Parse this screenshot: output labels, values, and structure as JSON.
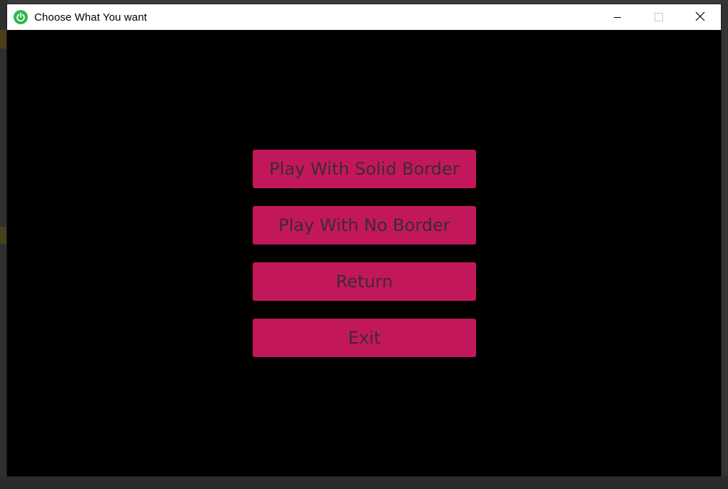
{
  "window": {
    "title": "Choose What You want",
    "icon": "power-icon",
    "controls": [
      "minimize-icon",
      "maximize-icon",
      "close-icon"
    ]
  },
  "menu": {
    "buttons": [
      {
        "label": "Play With Solid Border"
      },
      {
        "label": "Play With No Border"
      },
      {
        "label": "Return"
      },
      {
        "label": "Exit"
      }
    ]
  },
  "colors": {
    "button_bg": "#c2185b",
    "button_text": "#3d2a34",
    "content_bg": "#000000",
    "titlebar_bg": "#ffffff",
    "app_icon": "#2db84d"
  }
}
